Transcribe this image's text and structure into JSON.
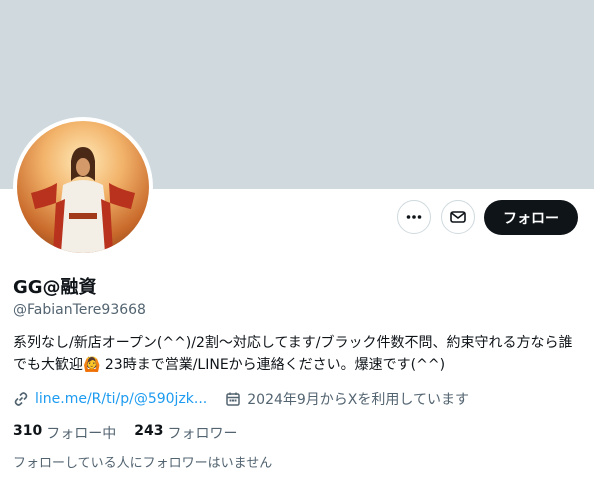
{
  "profile": {
    "display_name": "GG@融資",
    "handle": "@FabianTere93668",
    "bio": "系列なし/新店オープン(^^)/2割～対応してます/ブラック件数不問、約束守れる方なら誰でも大歓迎🙆 23時まで営業/LINEから連絡ください。爆速です(^^)",
    "link": "line.me/R/ti/p/@590jzk...",
    "joined": "2024年9月からXを利用しています"
  },
  "actions": {
    "follow_label": "フォロー"
  },
  "stats": {
    "following_count": "310",
    "following_label": "フォロー中",
    "followers_count": "243",
    "followers_label": "フォロワー"
  },
  "followers_you_know": "フォローしている人にフォロワーはいません",
  "colors": {
    "banner": "#cfd9de",
    "link": "#1d9bf0",
    "muted": "#536471",
    "follow_button": "#0f1419"
  },
  "icons": [
    "more-icon",
    "mail-icon",
    "link-icon",
    "calendar-icon"
  ]
}
